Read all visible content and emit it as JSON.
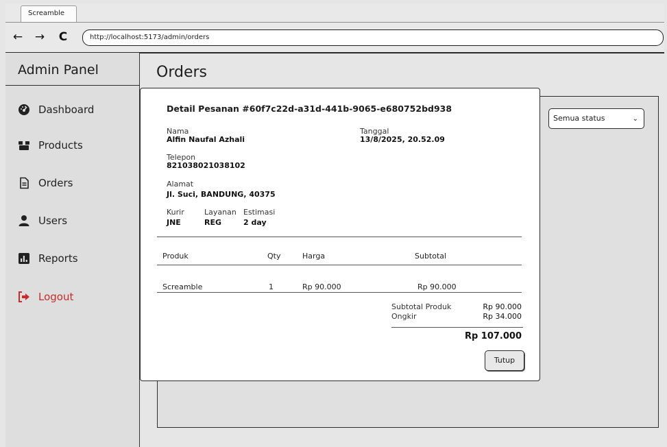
{
  "browser": {
    "tab_title": "Screamble",
    "back_glyph": "←",
    "forward_glyph": "→",
    "reload_glyph": "C",
    "url": "http://localhost:5173/admin/orders"
  },
  "sidebar": {
    "brand": "Admin Panel",
    "items": [
      {
        "label": "Dashboard",
        "icon": "dashboard-icon"
      },
      {
        "label": "Products",
        "icon": "box-icon"
      },
      {
        "label": "Orders",
        "icon": "document-icon"
      },
      {
        "label": "Users",
        "icon": "user-icon"
      },
      {
        "label": "Reports",
        "icon": "chart-icon"
      },
      {
        "label": "Logout",
        "icon": "logout-icon"
      }
    ]
  },
  "main": {
    "title": "Orders",
    "status_filter": "Semua status"
  },
  "modal": {
    "title": "Detail Pesanan #60f7c22d-a31d-441b-9065-e680752bd938",
    "name_label": "Nama",
    "name_value": "Alfin Naufal Azhali",
    "date_label": "Tanggal",
    "date_value": "13/8/2025, 20.52.09",
    "phone_label": "Telepon",
    "phone_value": "821038021038102",
    "address_label": "Alamat",
    "address_value": "Jl. Suci, BANDUNG, 40375",
    "courier_label": "Kurir",
    "courier_value": "JNE",
    "service_label": "Layanan",
    "service_value": "REG",
    "estimate_label": "Estimasi",
    "estimate_value": "2 day",
    "table": {
      "headers": [
        "Produk",
        "Qty",
        "Harga",
        "Subtotal"
      ],
      "rows": [
        [
          "Screamble",
          "1",
          "Rp 90.000",
          "Rp 90.000"
        ]
      ]
    },
    "subtotal_label": "Subtotal Produk",
    "subtotal_value": "Rp 90.000",
    "shipping_label": "Ongkir",
    "shipping_value": "Rp 34.000",
    "total_value": "Rp 107.000",
    "close_label": "Tutup"
  },
  "colors": {
    "logout": "#c92a2a",
    "background": "#e6e6e6"
  }
}
